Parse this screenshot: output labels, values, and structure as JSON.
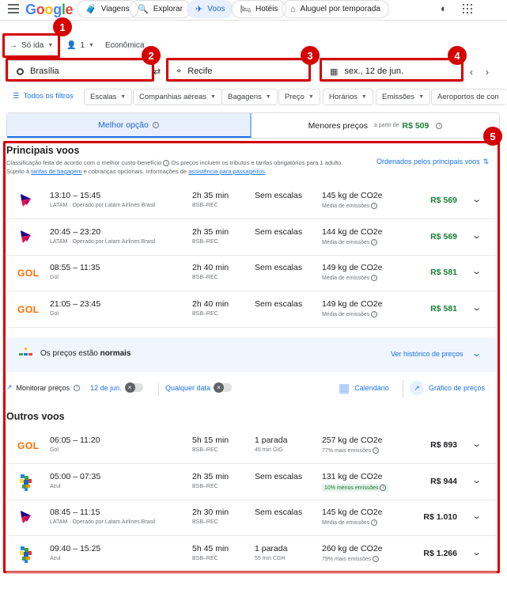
{
  "nav": {
    "logo": "Google",
    "items": [
      "Viagens",
      "Explorar",
      "Voos",
      "Hotéis",
      "Aluguel por temporada"
    ]
  },
  "search": {
    "trip_type": "Só ida",
    "passengers": "1",
    "cabin": "Econômica",
    "origin": "Brasília",
    "destination": "Recife",
    "date": "sex., 12 de jun."
  },
  "filters": {
    "all": "Todos os filtros",
    "items": [
      "Escalas",
      "Companhias aéreas",
      "Bagagens",
      "Preço",
      "Horários",
      "Emissões",
      "Aeroportos de con"
    ]
  },
  "sort": {
    "best": "Melhor opção",
    "cheapest": "Menores preços",
    "from": "a partir de",
    "cheapest_price": "R$ 509"
  },
  "badges": [
    "1",
    "2",
    "3",
    "4",
    "5"
  ],
  "main": {
    "title": "Principais voos",
    "note1": "Classificação feita de acordo com o melhor custo-benefício",
    "note2": "Os preços incluem os tributos e tarifas obrigatórios para 1 adulto.",
    "note3a": "Sujeito à",
    "note3b": "tarifas de bagagem",
    "note3c": "e cobranças opcionais. Informações de",
    "note3d": "assistência para passageiros",
    "note3e": ".",
    "sorted": "Ordenados pelos principais voos"
  },
  "top_flights": [
    {
      "logo": "latam",
      "time": "13:10 – 15:45",
      "airline": "LATAM · Operado por Latam Airlines Brasil",
      "duration": "2h 35 min",
      "route": "BSB–REC",
      "stops": "Sem escalas",
      "stop_detail": "",
      "co2": "145 kg de CO2e",
      "co2_sub": "Média de emissões",
      "price": "R$ 569",
      "green": true
    },
    {
      "logo": "latam",
      "time": "20:45 – 23:20",
      "airline": "LATAM · Operado por Latam Airlines Brasil",
      "duration": "2h 35 min",
      "route": "BSB–REC",
      "stops": "Sem escalas",
      "stop_detail": "",
      "co2": "144 kg de CO2e",
      "co2_sub": "Média de emissões",
      "price": "R$ 569",
      "green": true
    },
    {
      "logo": "gol",
      "time": "08:55 – 11:35",
      "airline": "Gol",
      "duration": "2h 40 min",
      "route": "BSB–REC",
      "stops": "Sem escalas",
      "stop_detail": "",
      "co2": "149 kg de CO2e",
      "co2_sub": "Média de emissões",
      "price": "R$ 581",
      "green": true
    },
    {
      "logo": "gol",
      "time": "21:05 – 23:45",
      "airline": "Gol",
      "duration": "2h 40 min",
      "route": "BSB–REC",
      "stops": "Sem escalas",
      "stop_detail": "",
      "co2": "149 kg de CO2e",
      "co2_sub": "Média de emissões",
      "price": "R$ 581",
      "green": true
    }
  ],
  "insight": {
    "text_a": "Os preços estão",
    "text_b": "normais",
    "link": "Ver histórico de preços"
  },
  "tracking": {
    "label": "Monitorar preços",
    "date": "12 de jun.",
    "any": "Qualquer data",
    "calendar": "Calendário",
    "graph": "Gráfico de preços"
  },
  "other": {
    "title": "Outros voos"
  },
  "other_flights": [
    {
      "logo": "gol",
      "time": "06:05 – 11:20",
      "airline": "Gol",
      "duration": "5h 15 min",
      "route": "BSB–REC",
      "stops": "1 parada",
      "stop_detail": "45 min GIG",
      "co2": "257 kg de CO2e",
      "co2_sub": "77% mais emissões",
      "good": false,
      "price": "R$ 893",
      "green": false
    },
    {
      "logo": "azul",
      "time": "05:00 – 07:35",
      "airline": "Azul",
      "duration": "2h 35 min",
      "route": "BSB–REC",
      "stops": "Sem escalas",
      "stop_detail": "",
      "co2": "131 kg de CO2e",
      "co2_sub": "10% menos emissões",
      "good": true,
      "price": "R$ 944",
      "green": false
    },
    {
      "logo": "latam",
      "time": "08:45 – 11:15",
      "airline": "LATAM · Operado por Latam Airlines Brasil",
      "duration": "2h 30 min",
      "route": "BSB–REC",
      "stops": "Sem escalas",
      "stop_detail": "",
      "co2": "145 kg de CO2e",
      "co2_sub": "Média de emissões",
      "good": false,
      "price": "R$ 1.010",
      "green": false
    },
    {
      "logo": "azul",
      "time": "09:40 – 15:25",
      "airline": "Azul",
      "duration": "5h 45 min",
      "route": "BSB–REC",
      "stops": "1 parada",
      "stop_detail": "55 min CGH",
      "co2": "260 kg de CO2e",
      "co2_sub": "79% mais emissões",
      "good": false,
      "price": "R$ 1.266",
      "green": false
    }
  ],
  "colors": {
    "annotation_red": "#d50000",
    "accent_blue": "#1a73e8",
    "price_green": "#188038"
  }
}
